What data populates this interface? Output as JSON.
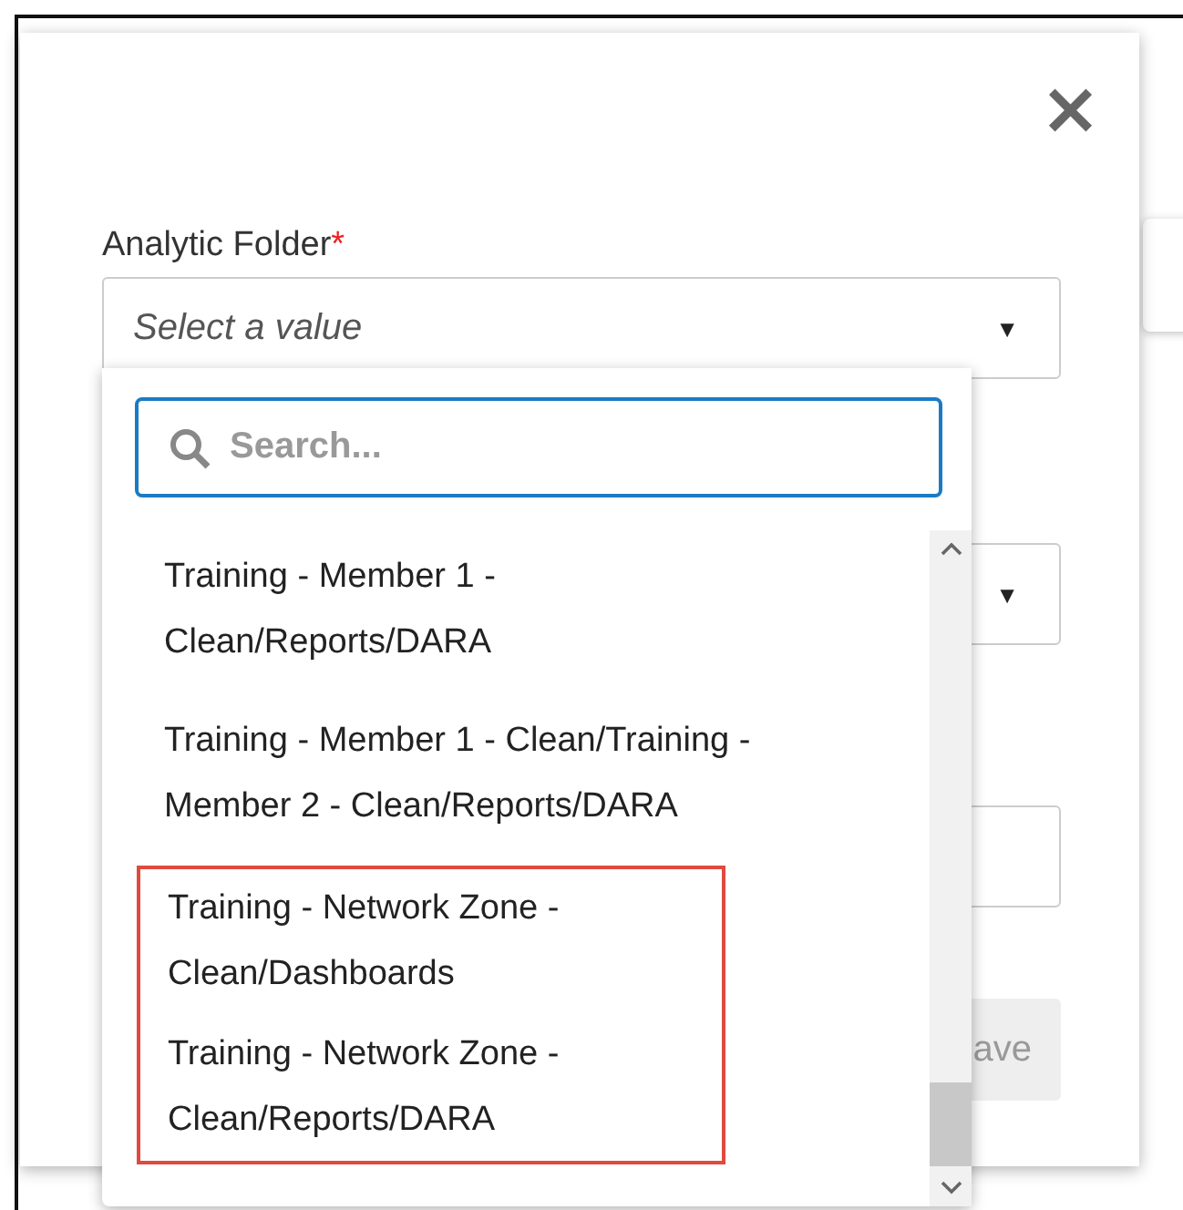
{
  "dialog": {
    "close_label": "×",
    "field": {
      "label": "Analytic Folder",
      "required_mark": "*",
      "placeholder": "Select a value",
      "caret": "▼"
    },
    "second_select": {
      "caret": "▼"
    },
    "save_button": {
      "label": "ave",
      "disabled": true
    }
  },
  "dropdown": {
    "search": {
      "placeholder": "Search..."
    },
    "options": [
      {
        "lines": [
          "Training - Member 1 -",
          "Clean/Reports/DARA"
        ],
        "highlighted": false
      },
      {
        "lines": [
          "Training - Member 1 - Clean/Training -",
          "Member 2 - Clean/Reports/DARA"
        ],
        "highlighted": false
      },
      {
        "lines": [
          "Training - Network Zone -",
          "Clean/Dashboards"
        ],
        "highlighted": true
      },
      {
        "lines": [
          "Training - Network Zone -",
          "Clean/Reports/DARA"
        ],
        "highlighted": true
      }
    ]
  }
}
